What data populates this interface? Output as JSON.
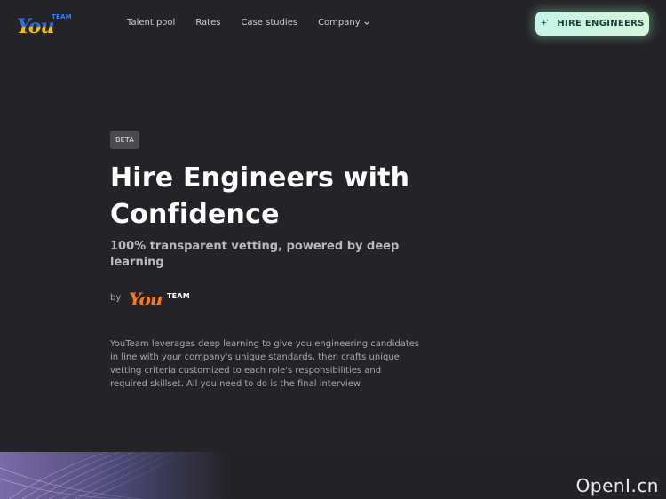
{
  "header": {
    "logo": {
      "mark": "You",
      "suffix": "TEAM"
    },
    "nav": [
      {
        "label": "Talent pool"
      },
      {
        "label": "Rates"
      },
      {
        "label": "Case studies"
      },
      {
        "label": "Company",
        "icon": "chevron-down-icon"
      }
    ],
    "cta": {
      "label": "HIRE ENGINEERS",
      "icon": "sparkle-icon"
    }
  },
  "hero": {
    "badge": "BETA",
    "title": "Hire Engineers with Confidence",
    "subtitle": "100% transparent vetting, powered by deep learning",
    "by": {
      "label": "by",
      "logo_mark": "You",
      "logo_suffix": "TEAM"
    },
    "description": "YouTeam leverages deep learning to give you engineering candidates in line with your company's unique standards, then crafts unique vetting criteria customized to each role's responsibilities and required skillset. All you need to do is the final interview."
  },
  "watermark": "OpenI.cn",
  "colors": {
    "background": "#242428",
    "cta_gradient_start": "#c6f4e7",
    "cta_gradient_end": "#d3f7d9",
    "brand_orange": "#f37a22",
    "brand_blue": "#2d6fe0",
    "brand_yellow": "#f2c200"
  }
}
